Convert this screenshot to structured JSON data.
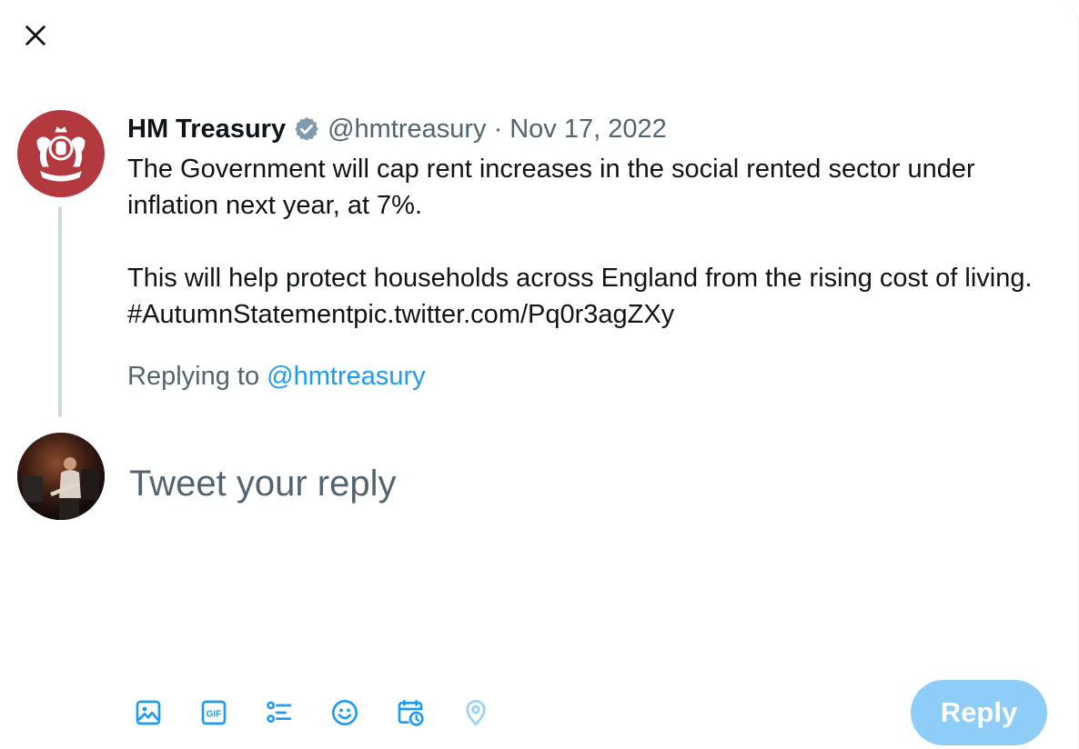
{
  "dialog": {
    "close_icon": "close-icon"
  },
  "original_tweet": {
    "author_name": "HM Treasury",
    "verified_icon": "verified-badge-icon",
    "handle": "@hmtreasury",
    "separator": "·",
    "date": "Nov 17, 2022",
    "text": "The Government will cap rent increases in the social rented sector under inflation next year, at 7%.\n\nThis will help protect households across England from the rising cost of living. #AutumnStatementpic.twitter.com/Pq0r3agZXy",
    "avatar_color": "#b23a3f"
  },
  "replying_to": {
    "prefix": "Replying to",
    "handle": "@hmtreasury"
  },
  "composer": {
    "placeholder": "Tweet your reply",
    "value": "",
    "tools": [
      {
        "name": "media-icon"
      },
      {
        "name": "gif-icon"
      },
      {
        "name": "poll-icon"
      },
      {
        "name": "emoji-icon"
      },
      {
        "name": "schedule-icon"
      },
      {
        "name": "location-icon"
      }
    ],
    "reply_button_label": "Reply"
  },
  "colors": {
    "accent": "#1d9bf0",
    "reply_button_disabled": "#8ecdf8",
    "secondary_text": "#536471",
    "thread_line": "#cfd9de"
  }
}
